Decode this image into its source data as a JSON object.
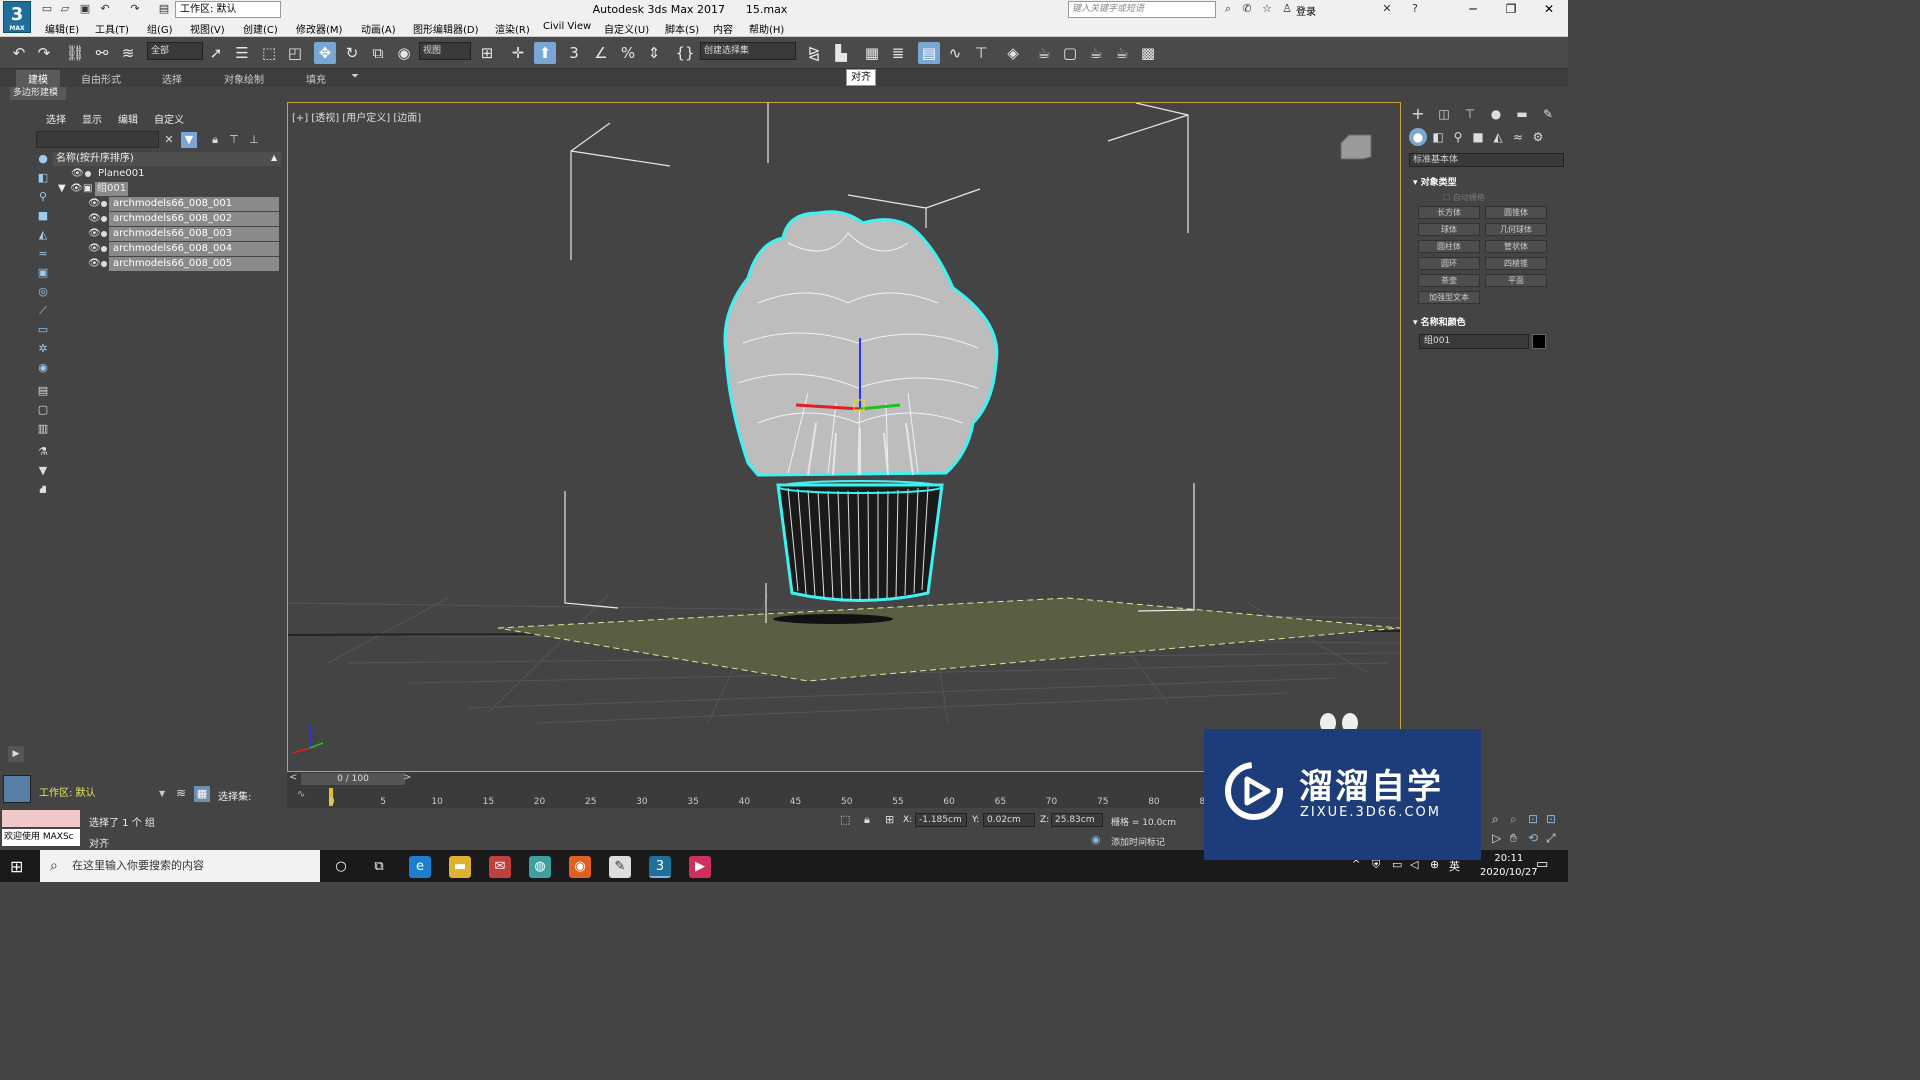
{
  "title_bar": {
    "app_logo_text": "3",
    "app_logo_sub": "MAX",
    "workspace_dropdown": "工作区: 默认",
    "app_title": "Autodesk 3ds Max 2017",
    "file_name": "15.max",
    "search_placeholder": "键入关键字或短语",
    "login_label": "登录"
  },
  "menu": {
    "items": [
      "编辑(E)",
      "工具(T)",
      "组(G)",
      "视图(V)",
      "创建(C)",
      "修改器(M)",
      "动画(A)",
      "图形编辑器(D)",
      "渲染(R)",
      "Civil View",
      "自定义(U)",
      "脚本(S)",
      "内容",
      "帮助(H)"
    ]
  },
  "toolbar": {
    "filter_dropdown": "全部",
    "view_dropdown": "视图",
    "selection_set_dropdown": "创建选择集",
    "tooltip": "对齐"
  },
  "ribbon": {
    "tabs": [
      "建模",
      "自由形式",
      "选择",
      "对象绘制",
      "填充"
    ],
    "active_tab": "建模",
    "sub_label": "多边形建模"
  },
  "scene_explorer": {
    "menu": [
      "选择",
      "显示",
      "编辑",
      "自定义"
    ],
    "header": "名称(按升序排序)",
    "rows": [
      {
        "label": "Plane001",
        "selected": false
      },
      {
        "label": "组001",
        "selected": true
      },
      {
        "label": "archmodels66_008_001",
        "selected": true
      },
      {
        "label": "archmodels66_008_002",
        "selected": true
      },
      {
        "label": "archmodels66_008_003",
        "selected": true
      },
      {
        "label": "archmodels66_008_004",
        "selected": true
      },
      {
        "label": "archmodels66_008_005",
        "selected": true
      }
    ],
    "workspace_label": "工作区: 默认",
    "selection_set_label": "选择集:"
  },
  "viewport": {
    "label": "[+] [透视] [用户定义] [边面]"
  },
  "command_panel": {
    "category_dropdown": "标准基本体",
    "section_object_type": "对象类型",
    "auto_grid": "自动栅格",
    "buttons": [
      "长方体",
      "圆锥体",
      "球体",
      "几何球体",
      "圆柱体",
      "管状体",
      "圆环",
      "四棱锥",
      "茶壶",
      "平面",
      "加强型文本"
    ],
    "section_name_color": "名称和颜色",
    "object_name": "组001",
    "object_color": "#000000"
  },
  "timeline": {
    "frame_display": "0 / 100",
    "ticks": [
      "0",
      "5",
      "10",
      "15",
      "20",
      "25",
      "30",
      "35",
      "40",
      "45",
      "50",
      "55",
      "60",
      "65",
      "70",
      "75",
      "80",
      "85"
    ]
  },
  "status_bar": {
    "welcome": "欢迎使用 MAXSc",
    "status": "选择了 1 个 组",
    "prompt": "对齐",
    "x_label": "X:",
    "x_value": "-1.185cm",
    "y_label": "Y:",
    "y_value": "0.02cm",
    "z_label": "Z:",
    "z_value": "25.83cm",
    "grid": "栅格 = 10.0cm",
    "add_time_tag": "添加时间标记"
  },
  "taskbar": {
    "search_placeholder": "在这里输入你要搜索的内容",
    "time": "20:11",
    "date": "2020/10/27",
    "ime": "英"
  },
  "watermark": {
    "title": "溜溜自学",
    "url": "ZIXUE.3D66.COM"
  }
}
